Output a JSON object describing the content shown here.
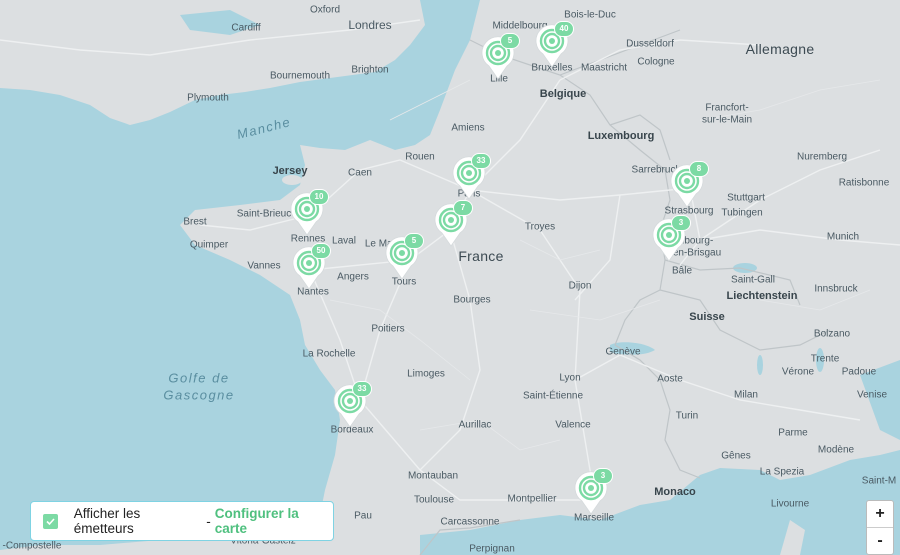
{
  "map": {
    "labels": {
      "oxford": "Oxford",
      "londres": "Londres",
      "cardiff": "Cardiff",
      "bournemouth": "Bournemouth",
      "brighton": "Brighton",
      "plymouth": "Plymouth",
      "middelbourg": "Middelbourg",
      "bois_le_duc": "Bois-le-Duc",
      "dusseldorf": "Dusseldorf",
      "cologne": "Cologne",
      "maastricht": "Maastricht",
      "bruxelles": "Bruxelles",
      "lille": "Lille",
      "belgique": "Belgique",
      "allemagne": "Allemagne",
      "frankfort": "Francfort-",
      "sur_le_main": "sur-le-Main",
      "luxembourg": "Luxembourg",
      "amiens": "Amiens",
      "manche": "Manche",
      "jersey": "Jersey",
      "caen": "Caen",
      "rouen": "Rouen",
      "paris": "Paris",
      "nuremberg": "Nuremberg",
      "ratisbonne": "Ratisbonne",
      "sarrebruck": "Sarrebruck",
      "stuttgart": "Stuttgart",
      "strasbourg": "Strasbourg",
      "tubingen": "Tubingen",
      "brest": "Brest",
      "saint_brieuc": "Saint-Brieuc",
      "rennes": "Rennes",
      "laval": "Laval",
      "le_mans": "Le Mans",
      "troyes": "Troyes",
      "munich": "Munich",
      "quimper": "Quimper",
      "fribourg": "Fribourg-",
      "en_brisgau": "en-Brisgau",
      "vannes": "Vannes",
      "angers": "Angers",
      "tours": "Tours",
      "france": "France",
      "bale": "Bâle",
      "saint_gall": "Saint-Gall",
      "nantes": "Nantes",
      "dijon": "Dijon",
      "liechtenstein": "Liechtenstein",
      "innsbruck": "Innsbruck",
      "bourges": "Bourges",
      "suisse": "Suisse",
      "poitiers": "Poitiers",
      "bolzano": "Bolzano",
      "la_rochelle": "La Rochelle",
      "geneve": "Genève",
      "trente": "Trente",
      "limoges": "Limoges",
      "lyon": "Lyon",
      "aoste": "Aoste",
      "golfe": "Golfe de",
      "gascogne": "Gascogne",
      "saint_etienne": "Saint-Étienne",
      "milan": "Milan",
      "venise": "Venise",
      "verone": "Vérone",
      "padoue": "Padoue",
      "bordeaux": "Bordeaux",
      "aurillac": "Aurillac",
      "valence": "Valence",
      "turin": "Turin",
      "parme": "Parme",
      "modene": "Modène",
      "genes": "Gênes",
      "la_spezia": "La Spezia",
      "montauban": "Montauban",
      "monaco": "Monaco",
      "toulouse": "Toulouse",
      "montpellier": "Montpellier",
      "marseille": "Marseille",
      "livourne": "Livourne",
      "saint_m": "Saint-M",
      "carcassonne": "Carcassonne",
      "pau": "Pau",
      "perpignan": "Perpignan",
      "vitoria": "Vitoria-Gasteiz",
      "compostelle": "-Compostelle"
    },
    "markers": [
      {
        "id": "lille",
        "count": "5"
      },
      {
        "id": "bruxelles",
        "count": "40"
      },
      {
        "id": "paris",
        "count": "33"
      },
      {
        "id": "strasbourg",
        "count": "8"
      },
      {
        "id": "rennes",
        "count": "10"
      },
      {
        "id": "orleans",
        "count": "7"
      },
      {
        "id": "fribourg",
        "count": "3"
      },
      {
        "id": "tours",
        "count": "5"
      },
      {
        "id": "nantes",
        "count": "50"
      },
      {
        "id": "bordeaux",
        "count": "33"
      },
      {
        "id": "marseille",
        "count": "3"
      }
    ],
    "marker_color": "#7cdaa4"
  },
  "legend": {
    "checkbox_checked": true,
    "label": "Afficher les émetteurs",
    "separator": "-",
    "link": "Configurer la carte"
  },
  "zoom": {
    "in_label": "+",
    "out_label": "-"
  }
}
